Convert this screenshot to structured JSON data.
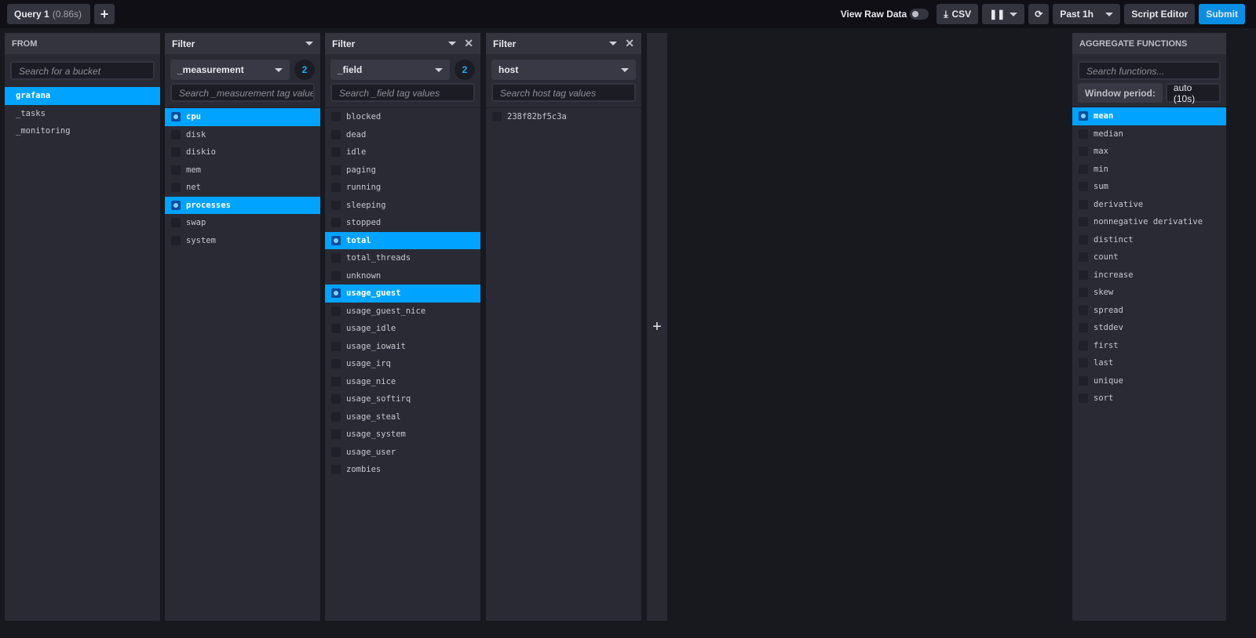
{
  "topbar": {
    "query_tab": "Query 1",
    "query_time": "(0.86s)",
    "add_query": "+",
    "view_raw": "View Raw Data",
    "csv": "CSV",
    "refresh_range": "Past 1h",
    "script_editor": "Script Editor",
    "submit": "Submit"
  },
  "from": {
    "title": "FROM",
    "search_placeholder": "Search for a bucket",
    "buckets": [
      {
        "label": "grafana",
        "selected": true
      },
      {
        "label": "_tasks"
      },
      {
        "label": "_monitoring"
      }
    ]
  },
  "filters": [
    {
      "title": "Filter",
      "key": "_measurement",
      "count": "2",
      "search_placeholder": "Search _measurement tag values",
      "closable": false,
      "values": [
        {
          "label": "cpu",
          "selected": true
        },
        {
          "label": "disk"
        },
        {
          "label": "diskio"
        },
        {
          "label": "mem"
        },
        {
          "label": "net"
        },
        {
          "label": "processes",
          "selected": true
        },
        {
          "label": "swap"
        },
        {
          "label": "system"
        }
      ]
    },
    {
      "title": "Filter",
      "key": "_field",
      "count": "2",
      "search_placeholder": "Search _field tag values",
      "closable": true,
      "values": [
        {
          "label": "blocked"
        },
        {
          "label": "dead"
        },
        {
          "label": "idle"
        },
        {
          "label": "paging"
        },
        {
          "label": "running"
        },
        {
          "label": "sleeping"
        },
        {
          "label": "stopped"
        },
        {
          "label": "total",
          "selected": true
        },
        {
          "label": "total_threads"
        },
        {
          "label": "unknown"
        },
        {
          "label": "usage_guest",
          "selected": true
        },
        {
          "label": "usage_guest_nice"
        },
        {
          "label": "usage_idle"
        },
        {
          "label": "usage_iowait"
        },
        {
          "label": "usage_irq"
        },
        {
          "label": "usage_nice"
        },
        {
          "label": "usage_softirq"
        },
        {
          "label": "usage_steal"
        },
        {
          "label": "usage_system"
        },
        {
          "label": "usage_user"
        },
        {
          "label": "zombies"
        }
      ]
    },
    {
      "title": "Filter",
      "key": "host",
      "count": "",
      "search_placeholder": "Search host tag values",
      "closable": true,
      "values": [
        {
          "label": "238f82bf5c3a"
        }
      ]
    }
  ],
  "add_filter": "+",
  "aggregate": {
    "title": "AGGREGATE FUNCTIONS",
    "search_placeholder": "Search functions...",
    "window_label": "Window period:",
    "window_value": "auto (10s)",
    "functions": [
      {
        "label": "mean",
        "selected": true
      },
      {
        "label": "median"
      },
      {
        "label": "max"
      },
      {
        "label": "min"
      },
      {
        "label": "sum"
      },
      {
        "label": "derivative"
      },
      {
        "label": "nonnegative derivative"
      },
      {
        "label": "distinct"
      },
      {
        "label": "count"
      },
      {
        "label": "increase"
      },
      {
        "label": "skew"
      },
      {
        "label": "spread"
      },
      {
        "label": "stddev"
      },
      {
        "label": "first"
      },
      {
        "label": "last"
      },
      {
        "label": "unique"
      },
      {
        "label": "sort"
      }
    ]
  }
}
